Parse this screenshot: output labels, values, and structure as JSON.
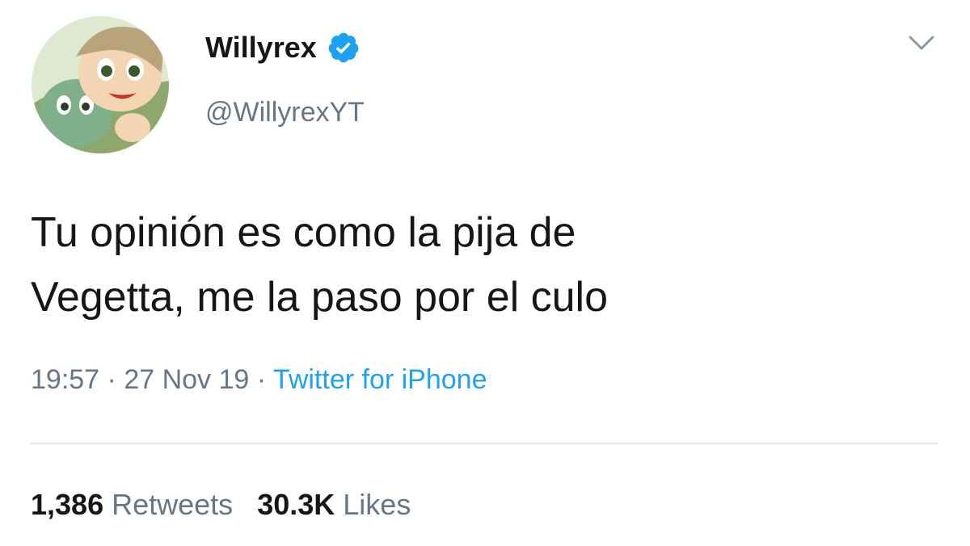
{
  "user": {
    "display_name": "Willyrex",
    "handle": "@WillyrexYT",
    "verified": true
  },
  "tweet": {
    "text_lines": [
      "Tu opinión es como la pija de",
      "Vegetta, me la paso por el culo"
    ],
    "time": "19:57",
    "separator": " · ",
    "date": "27 Nov 19",
    "source": "Twitter for iPhone"
  },
  "stats": {
    "retweets_count": "1,386",
    "retweets_label": "Retweets",
    "likes_count": "30.3K",
    "likes_label": "Likes"
  },
  "icons": {
    "verified": "verified-badge-icon",
    "menu": "chevron-down-icon"
  },
  "colors": {
    "text": "#14171a",
    "muted": "#657786",
    "link": "#1da1f2",
    "divider": "#e1e8ed"
  }
}
